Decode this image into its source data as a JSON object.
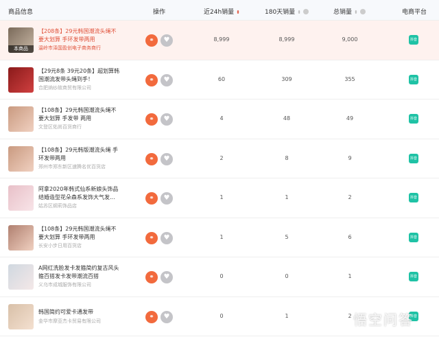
{
  "header": {
    "product": "商品信息",
    "action": "操作",
    "sales_24h": "近24h销量",
    "sales_180d": "180天销量",
    "sales_total": "总销量",
    "platform": "电商平台"
  },
  "accent": "#f26a3d",
  "platform_color": "#1fc2a5",
  "rows": [
    {
      "title": "【208条】29元韩国潮流头绳不要大划算 手环发带两用",
      "shop": "温岭市泽国盈创电子商务商行",
      "tag": "本商品",
      "s24": "8,999",
      "s180": "8,999",
      "total": "9,000",
      "platform": "抖音",
      "highlight": true
    },
    {
      "title": "【29元8条 39元20条】超划算韩国潮流发带头绳到手！",
      "shop": "合肥纳纱故商贸有限公司",
      "s24": "60",
      "s180": "309",
      "total": "355",
      "platform": "抖音"
    },
    {
      "title": "【108条】29元韩国潮流头绳不要大划算 手发带 两用",
      "shop": "文登区佑尚百货商行",
      "s24": "4",
      "s180": "48",
      "total": "49",
      "platform": "抖音"
    },
    {
      "title": "【108条】29元韩版潮流头绳 手环发带两用",
      "shop": "郑州市郑东新区速腾名优百货店",
      "s24": "2",
      "s180": "8",
      "total": "9",
      "platform": "抖音"
    },
    {
      "title": "阿拿2020年韩式仙系新娘头饰品结婚造型花朵森系发饰大气发...",
      "shop": "姑苏区纲莉饰品店",
      "s24": "1",
      "s180": "1",
      "total": "2",
      "platform": "抖音"
    },
    {
      "title": "【108条】29元韩国潮流头绳不要大划算 手环发带两用",
      "shop": "长安小步日用百货店",
      "s24": "1",
      "s180": "5",
      "total": "6",
      "platform": "抖音"
    },
    {
      "title": "A网红洗脸发卡发箍简约复古风头箍百搭发卡发带潮流百搭",
      "shop": "义乌市成城服饰有限公司",
      "s24": "0",
      "s180": "0",
      "total": "1",
      "platform": "抖音"
    },
    {
      "title": "韩国简约可爱卡通发带",
      "shop": "金华市摩亚杰卡贸易有限公司",
      "s24": "0",
      "s180": "1",
      "total": "2",
      "platform": "抖音"
    }
  ],
  "watermark": "悟空问答"
}
